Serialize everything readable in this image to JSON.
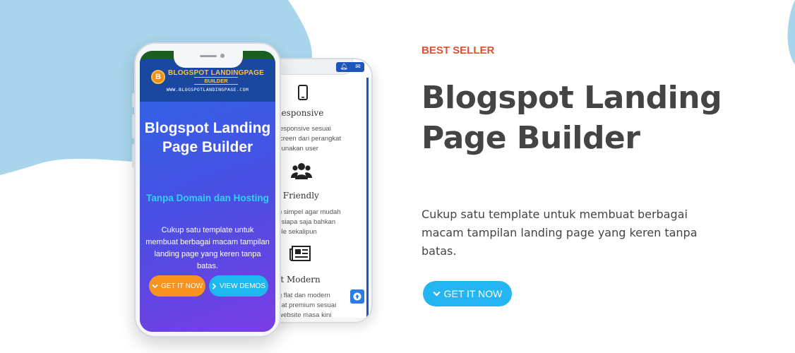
{
  "colors": {
    "blob": "#a8d5ec",
    "accent_red": "#e0502f",
    "title_gray": "#444444",
    "cta_blue": "#23b6f2",
    "orange": "#f7931e",
    "cyan": "#1fb8ee"
  },
  "back_phone": {
    "status_icons": [
      "bell-icon",
      "chat-icon"
    ],
    "features": [
      {
        "icon": "mobile-phone-icon",
        "title": "ll Responsive",
        "lines": [
          "full responsive sesuai",
          "an screen dari perangkat",
          "g digunakan user"
        ]
      },
      {
        "icon": "users-group-icon",
        "title": "ser Friendly",
        "lines": [
          "ngan simpel agar mudah",
          "oleh siapa saja bahkan",
          "i nuble sekalipun"
        ]
      },
      {
        "icon": "newspaper-icon",
        "title": "Flat Modern",
        "lines": [
          "gang flat dan modern",
          "terlihat premium sesuai",
          "ern website masa kini"
        ]
      }
    ],
    "scroll_top_icon": "arrow-up-icon"
  },
  "front_phone": {
    "logo": {
      "mark": "B",
      "line1": "BLOGSPOT LANDINGPAGE",
      "line2": "BUILDER",
      "url": "WWW.BLOGSPOTLANDINGPAGE.COM"
    },
    "hero_title": "Blogspot Landing Page Builder",
    "hero_subtitle": "Tanpa Domain dan Hosting",
    "hero_desc": "Cukup satu template untuk membuat berbagai macam tampilan landing page yang keren tanpa batas.",
    "btn_get": "GET IT NOW",
    "btn_demos": "VIEW DEMOS"
  },
  "content": {
    "eyebrow": "BEST SELLER",
    "title": "Blogspot Landing Page Builder",
    "description": "Cukup satu template untuk membuat berbagai macam tampilan landing page yang keren tanpa batas.",
    "cta": "GET IT NOW"
  }
}
